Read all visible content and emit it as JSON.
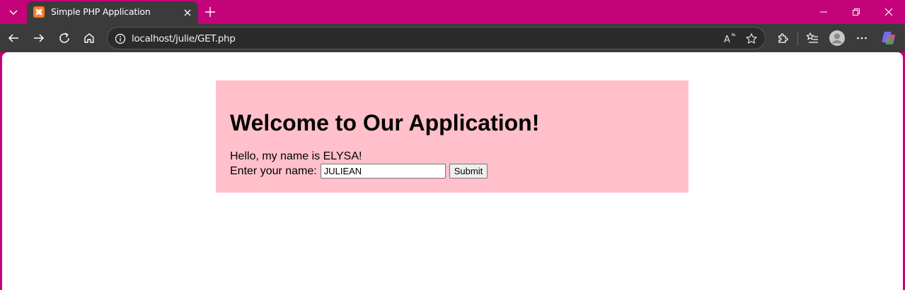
{
  "window": {
    "accent_color": "#c4037a"
  },
  "tab": {
    "title": "Simple PHP Application",
    "favicon": "xampp-icon"
  },
  "address_bar": {
    "url": "localhost/julie/GET.php"
  },
  "page": {
    "heading": "Welcome to Our Application!",
    "greeting": "Hello, my name is ELYSA!",
    "form_label": "Enter your name:",
    "name_input_value": "JULIEAN",
    "submit_label": "Submit",
    "card_color": "#ffc0cb"
  }
}
